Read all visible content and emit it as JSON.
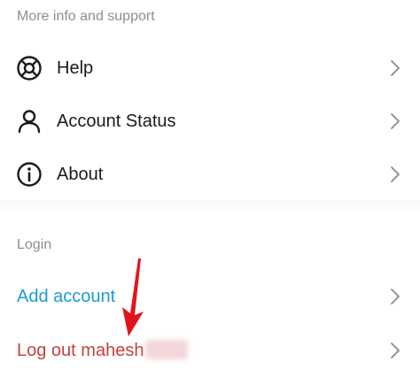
{
  "sections": {
    "support": {
      "title": "More info and support",
      "items": [
        {
          "label": "Help",
          "icon": "lifebuoy-icon"
        },
        {
          "label": "Account Status",
          "icon": "person-icon"
        },
        {
          "label": "About",
          "icon": "info-icon"
        }
      ]
    },
    "login": {
      "title": "Login",
      "add_account": "Add account",
      "logout": "Log out mahesh"
    }
  },
  "colors": {
    "link": "#1a9bd7",
    "danger": "#c5403f",
    "section_title": "#8e8e8e",
    "annotation_arrow": "#e3131b"
  }
}
